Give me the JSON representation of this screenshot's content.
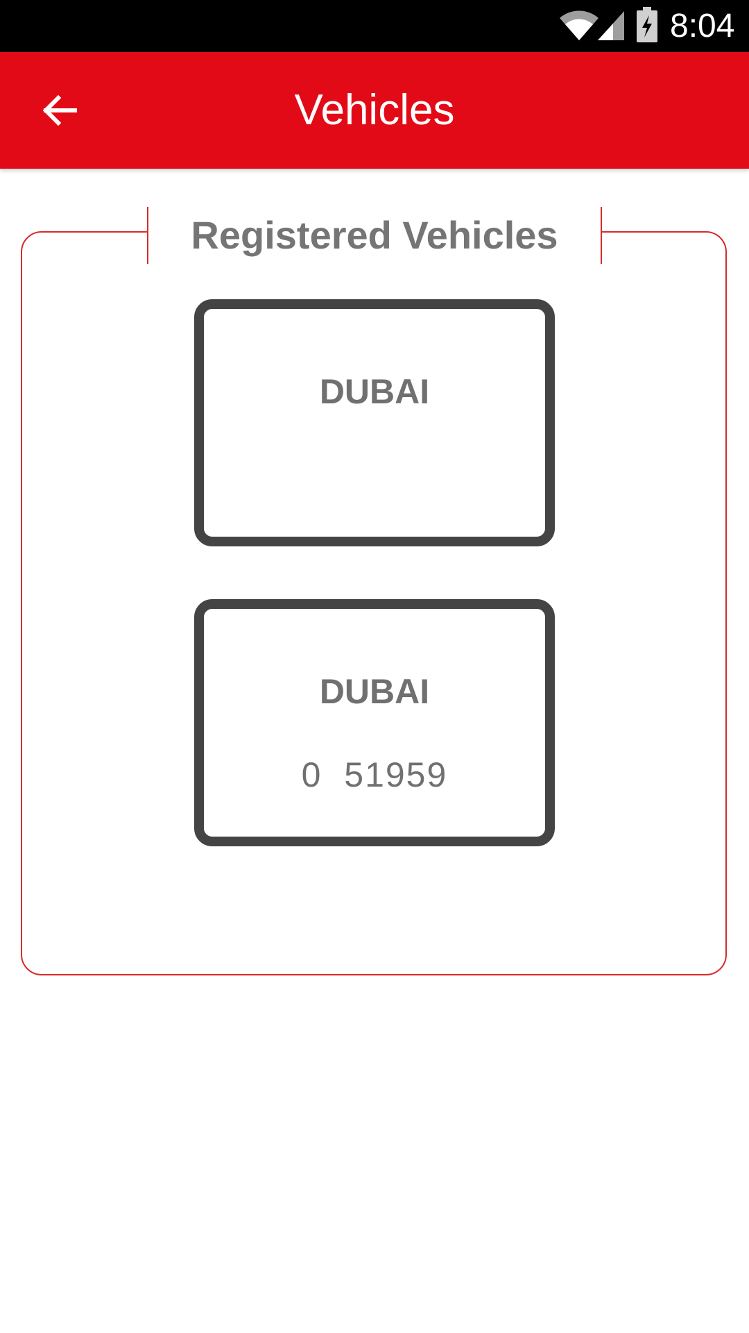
{
  "status_bar": {
    "time": "8:04",
    "icons": [
      "wifi-icon",
      "signal-icon",
      "battery-charging-icon"
    ]
  },
  "app_bar": {
    "back_icon": "arrow-left-icon",
    "title": "Vehicles"
  },
  "panel": {
    "title": "Registered Vehicles",
    "vehicles": [
      {
        "emirate": "DUBAI",
        "number": ""
      },
      {
        "emirate": "DUBAI",
        "number": "0  51959"
      }
    ]
  },
  "colors": {
    "app_bar": "#e30a17",
    "panel_border": "#d82a2a",
    "plate_border": "#444444",
    "text_gray": "#757575"
  }
}
